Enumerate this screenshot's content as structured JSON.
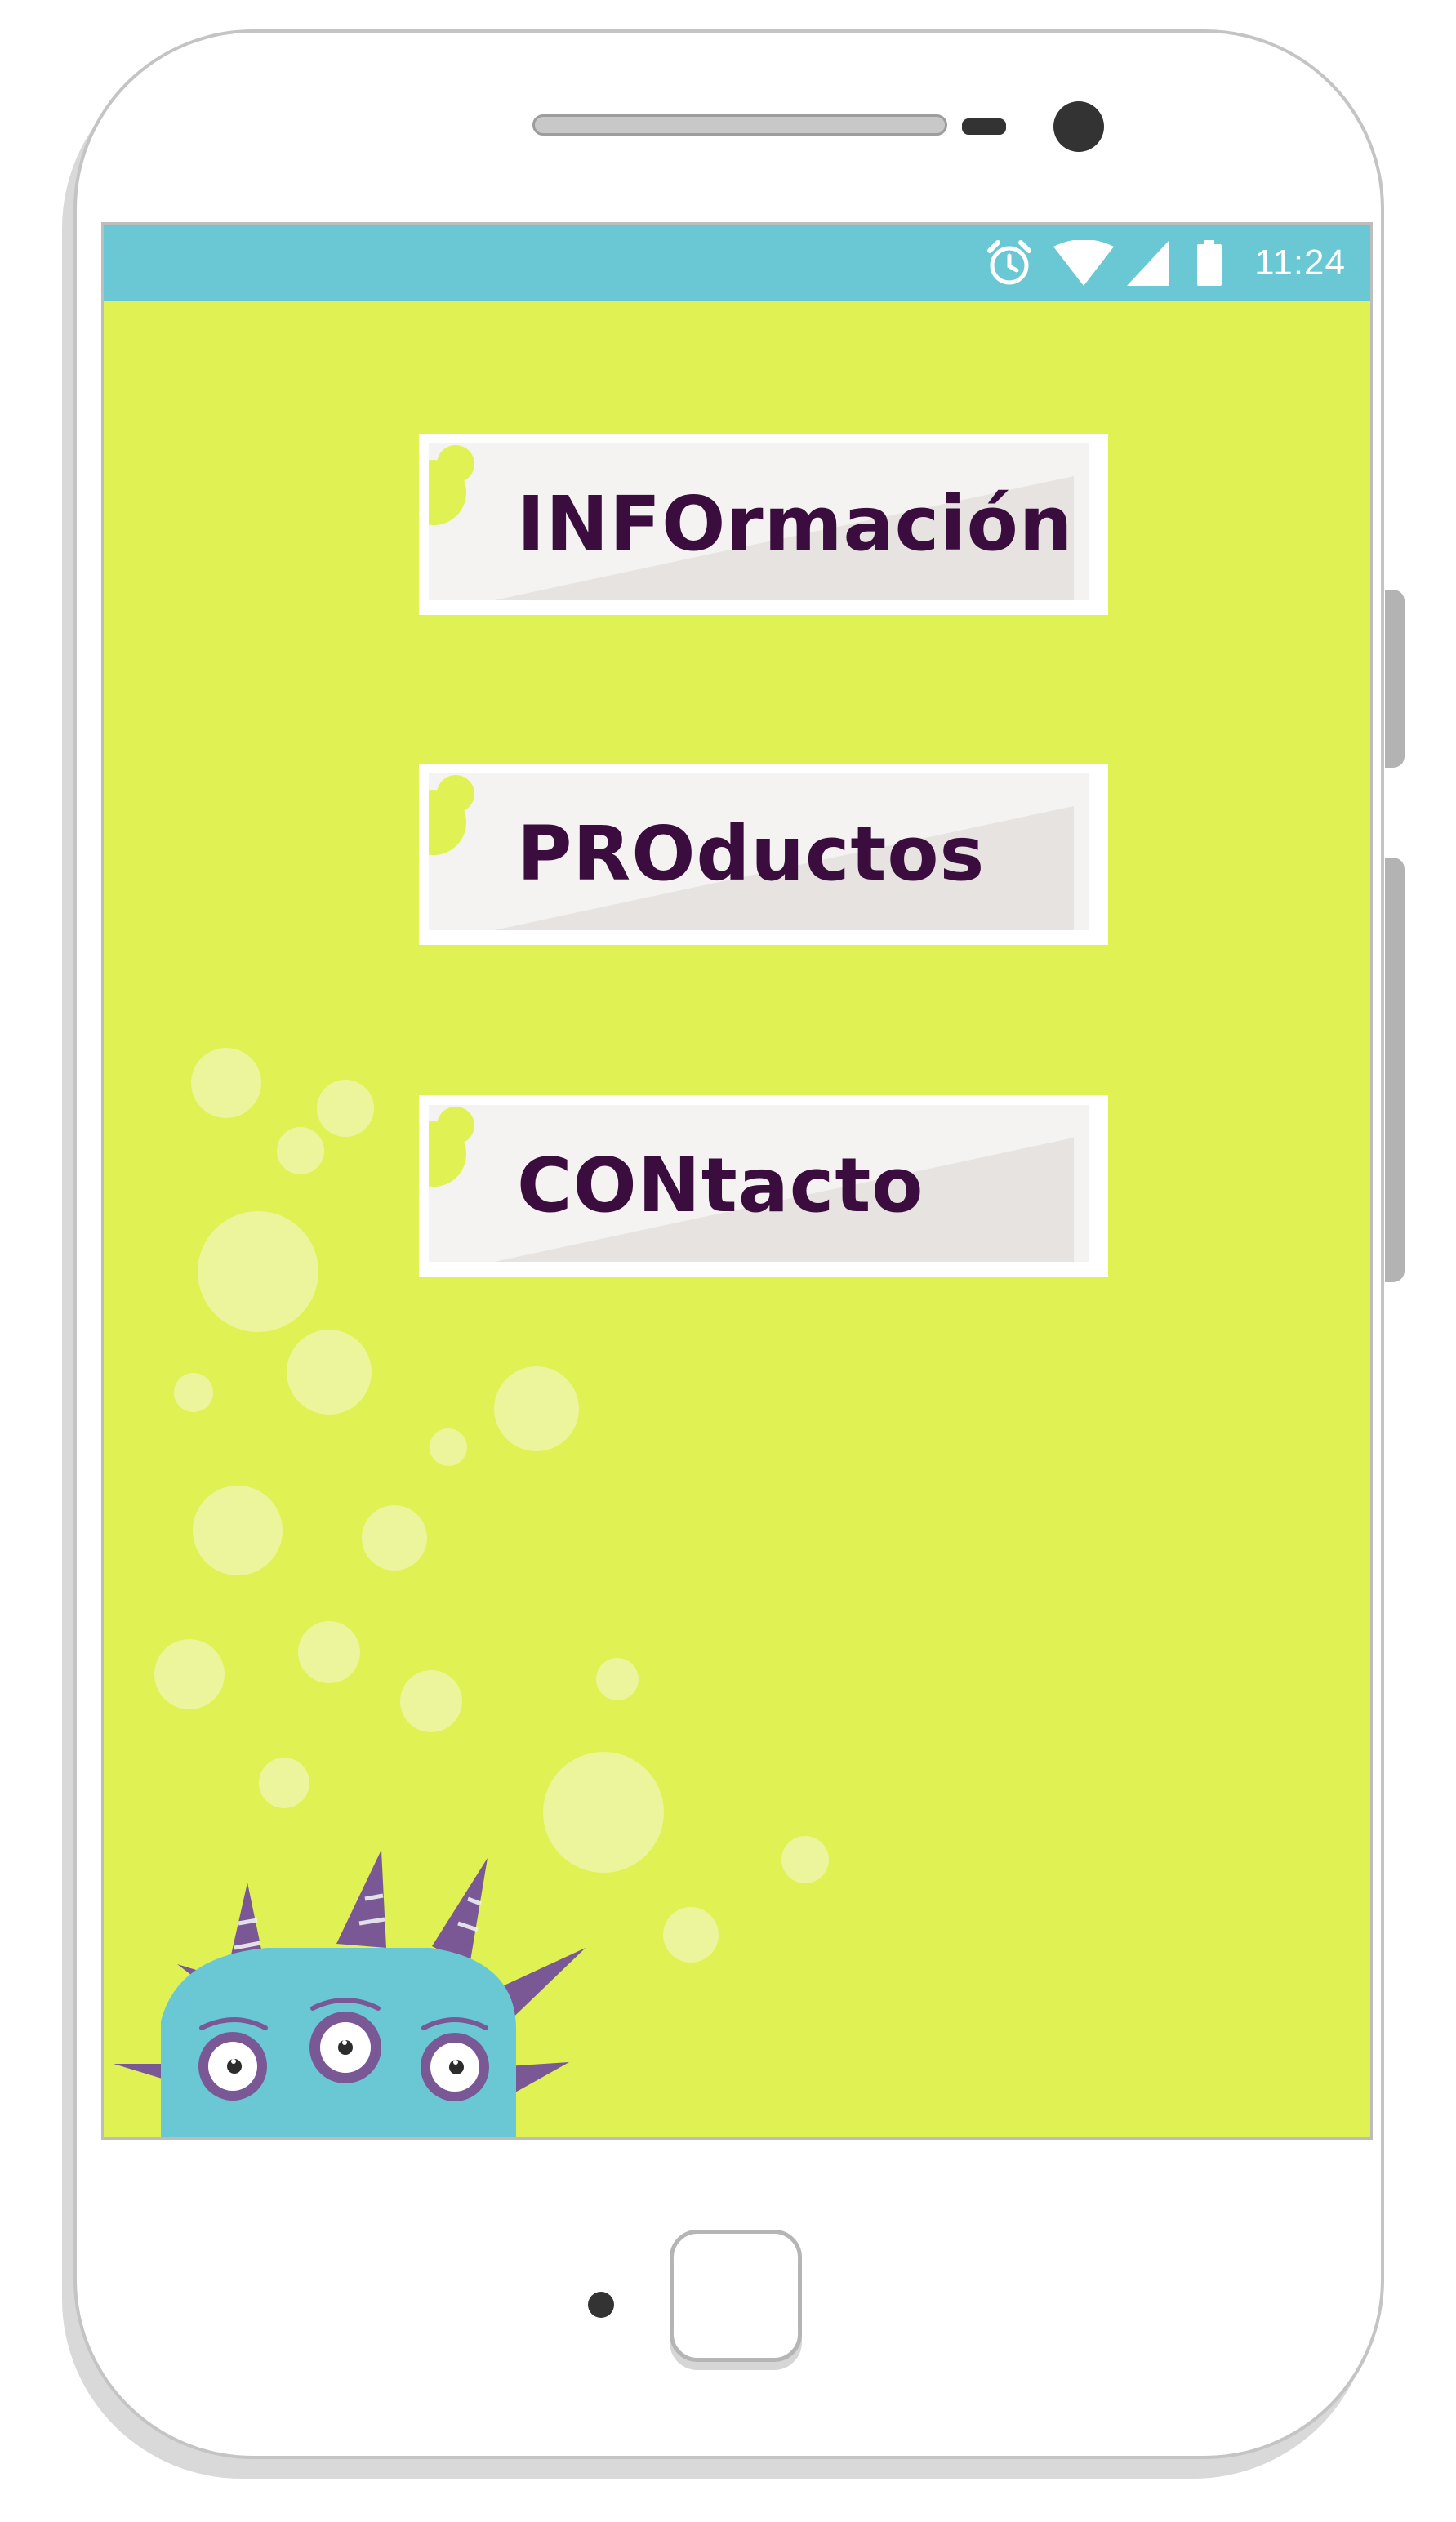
{
  "status_bar": {
    "time": "11:24",
    "icons": [
      "alarm-icon",
      "wifi-icon",
      "signal-icon",
      "battery-icon"
    ]
  },
  "menu": {
    "items": [
      {
        "label": "INFOrmación"
      },
      {
        "label": "PROductos"
      },
      {
        "label": "CONtacto"
      }
    ]
  },
  "colors": {
    "background": "#dff153",
    "status_bar": "#6ac8d4",
    "button_text": "#3a0d3e",
    "monster_body": "#6ac8d4",
    "monster_horns": "#7a5896"
  },
  "decor": {
    "mascot": "three-eyed-monster-illustration",
    "bubbles": "bubbles-decoration"
  }
}
